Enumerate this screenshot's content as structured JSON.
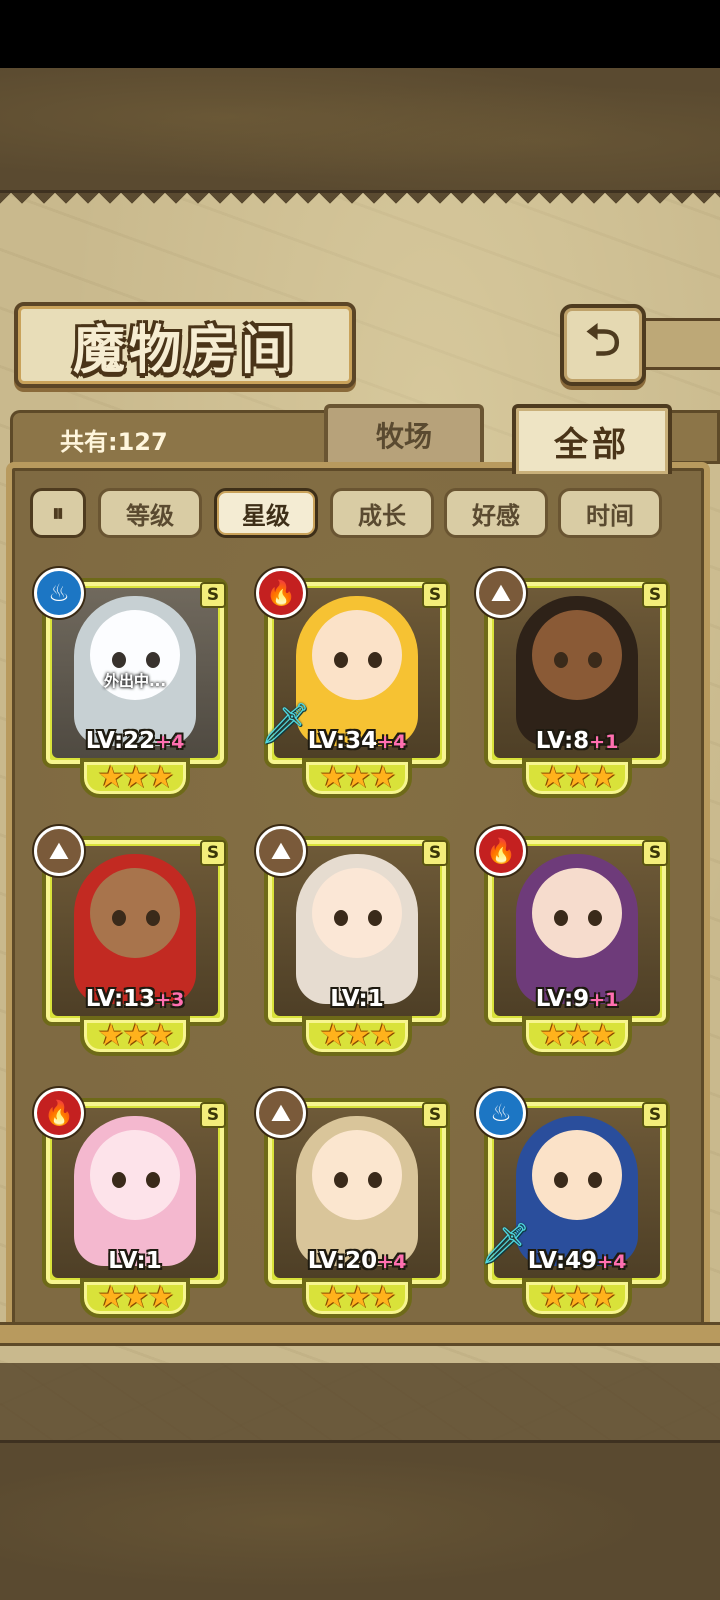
{
  "header": {
    "title": "魔物房间",
    "back_icon_glyph": "⮌"
  },
  "summary": {
    "count_label": "共有:127"
  },
  "tabs": [
    {
      "label": "牧场",
      "active": false
    },
    {
      "label": "全部",
      "active": true
    }
  ],
  "sort": {
    "toggle_glyph": "⏸",
    "options": [
      {
        "label": "等级",
        "active": false
      },
      {
        "label": "星级",
        "active": true
      },
      {
        "label": "成长",
        "active": false
      },
      {
        "label": "好感",
        "active": false
      },
      {
        "label": "时间",
        "active": false
      }
    ]
  },
  "cards": [
    {
      "element": "water",
      "element_glyph": "♨",
      "grade": "S",
      "level": "LV:22",
      "plus": "+4",
      "stars": "★★★",
      "status": "外出中...",
      "weapon": false,
      "skin": "#d8dde0",
      "hair": "#9fb8c2"
    },
    {
      "element": "fire",
      "element_glyph": "🔥",
      "grade": "S",
      "level": "LV:34",
      "plus": "+4",
      "stars": "★★★",
      "status": "",
      "weapon": true,
      "skin": "#fbe2c8",
      "hair": "#f6c233"
    },
    {
      "element": "earth",
      "element_glyph": "⛰",
      "grade": "S",
      "level": "LV:8",
      "plus": "+1",
      "stars": "★★★",
      "status": "",
      "weapon": false,
      "skin": "#8a5a36",
      "hair": "#2e2218"
    },
    {
      "element": "earth",
      "element_glyph": "⛰",
      "grade": "S",
      "level": "LV:13",
      "plus": "+3",
      "stars": "★★★",
      "status": "",
      "weapon": false,
      "skin": "#a8744c",
      "hair": "#c22a22"
    },
    {
      "element": "earth",
      "element_glyph": "⛰",
      "grade": "S",
      "level": "LV:1",
      "plus": "",
      "stars": "★★★",
      "status": "",
      "weapon": false,
      "skin": "#fbe7d6",
      "hair": "#e6dcd0"
    },
    {
      "element": "fire",
      "element_glyph": "🔥",
      "grade": "S",
      "level": "LV:9",
      "plus": "+1",
      "stars": "★★★",
      "status": "",
      "weapon": false,
      "skin": "#f6dccd",
      "hair": "#6e3b7a"
    },
    {
      "element": "fire",
      "element_glyph": "🔥",
      "grade": "S",
      "level": "LV:1",
      "plus": "",
      "stars": "★★★",
      "status": "",
      "weapon": false,
      "skin": "#fde3ea",
      "hair": "#f4b8cf"
    },
    {
      "element": "earth",
      "element_glyph": "⛰",
      "grade": "S",
      "level": "LV:20",
      "plus": "+4",
      "stars": "★★★",
      "status": "",
      "weapon": false,
      "skin": "#fbe6cf",
      "hair": "#d9c59a"
    },
    {
      "element": "water",
      "element_glyph": "♨",
      "grade": "S",
      "level": "LV:49",
      "plus": "+4",
      "stars": "★★★",
      "status": "",
      "weapon": true,
      "skin": "#fbe2c8",
      "hair": "#2a4e9c"
    }
  ],
  "colors": {
    "card_frame": "#d9e23a",
    "water": "#1c76c4",
    "fire": "#c42020",
    "earth": "#7a5a3a",
    "plus_text": "#ff6fb0"
  }
}
